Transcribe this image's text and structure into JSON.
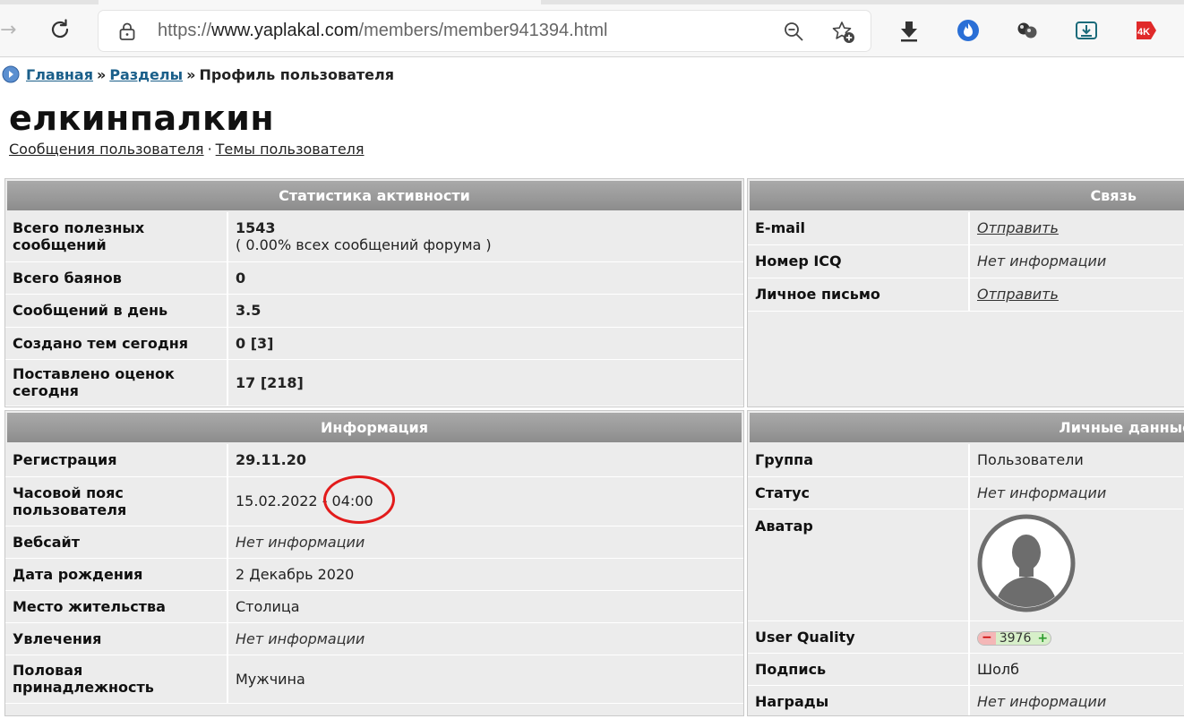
{
  "browser": {
    "url_scheme": "https://",
    "url_host": "www.yaplakal.com",
    "url_path": "/members/member941394.html",
    "icons": [
      "forward-icon",
      "reload-icon",
      "lock-icon",
      "zoom-out-icon",
      "add-favorite-icon",
      "download-icon",
      "extension-fire-icon",
      "extension-balls-icon",
      "extension-save-icon",
      "extension-4k-icon"
    ],
    "ext_4k_label": "4K"
  },
  "breadcrumb": {
    "home": "Главная",
    "sep1": "»",
    "sections": "Разделы",
    "sep2": "»",
    "current": "Профиль пользователя"
  },
  "profile": {
    "username": "елкинпалкин",
    "messages_link": "Сообщения пользователя",
    "links_sep": "·",
    "topics_link": "Темы пользователя"
  },
  "stats": {
    "title": "Статистика активности",
    "rows": [
      {
        "label": "Всего полезных сообщений",
        "value": "1543",
        "sub": "( 0.00% всех сообщений форума )"
      },
      {
        "label": "Всего баянов",
        "value": "0"
      },
      {
        "label": "Сообщений в день",
        "value": "3.5"
      },
      {
        "label": "Создано тем сегодня",
        "value": "0 [3]"
      },
      {
        "label": "Поставлено оценок сегодня",
        "value": "17 [218]"
      }
    ]
  },
  "contact": {
    "title": "Связь",
    "rows": [
      {
        "label": "E-mail",
        "value": "Отправить"
      },
      {
        "label": "Номер ICQ",
        "value": "Нет информации"
      },
      {
        "label": "Личное письмо",
        "value": "Отправить"
      }
    ]
  },
  "info": {
    "title": "Информация",
    "rows": [
      {
        "label": "Регистрация",
        "value": "29.11.20"
      },
      {
        "label": "Часовой пояс пользователя",
        "value": "15.02.2022 - 04:00"
      },
      {
        "label": "Вебсайт",
        "value": "Нет информации"
      },
      {
        "label": "Дата рождения",
        "value": "2 Декабрь 2020"
      },
      {
        "label": "Место жительства",
        "value": "Столица"
      },
      {
        "label": "Увлечения",
        "value": "Нет информации"
      },
      {
        "label": "Половая принадлежность",
        "value": "Мужчина"
      }
    ]
  },
  "personal": {
    "title": "Личные данные",
    "rows": [
      {
        "label": "Группа",
        "value": "Пользователи"
      },
      {
        "label": "Статус",
        "value": "Нет информации"
      },
      {
        "label": "Аватар",
        "value": "avatar-icon"
      },
      {
        "label": "User Quality",
        "minus": "−",
        "value": "3976",
        "plus": "+"
      },
      {
        "label": "Подпись",
        "value": "Шолб"
      },
      {
        "label": "Награды",
        "value": "Нет информации"
      }
    ]
  },
  "colors": {
    "link": "#1a5f8a",
    "panel_bg": "#ececec",
    "header_bg": "#9a9a9a",
    "highlight": "#e21b1b"
  }
}
